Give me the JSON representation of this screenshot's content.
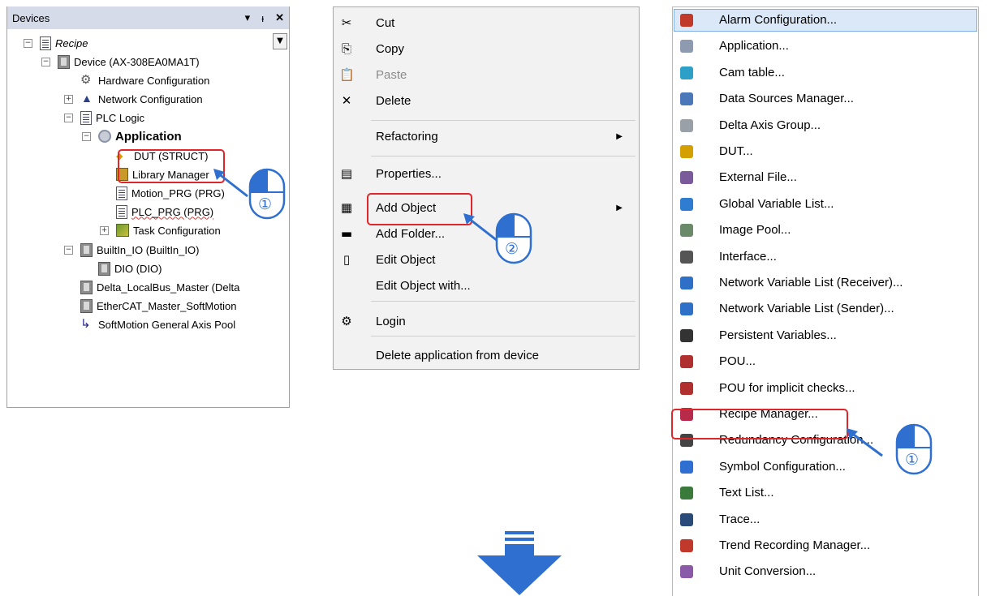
{
  "devices_panel": {
    "title": "Devices",
    "header_buttons": [
      "▾",
      "ᵼ",
      "✕"
    ],
    "tree": [
      {
        "label": "Recipe",
        "icon": "project-icon",
        "style": "ital"
      },
      {
        "label": "Device (AX-308EA0MA1T)",
        "icon": "device-icon"
      },
      {
        "label": "Hardware Configuration",
        "icon": "hardware-config-icon"
      },
      {
        "label": "Network Configuration",
        "icon": "network-config-icon"
      },
      {
        "label": "PLC Logic",
        "icon": "plc-logic-icon"
      },
      {
        "label": "Application",
        "icon": "application-icon",
        "style": "bold"
      },
      {
        "label": "DUT (STRUCT)",
        "icon": "dut-icon"
      },
      {
        "label": "Library Manager",
        "icon": "library-manager-icon"
      },
      {
        "label": "Motion_PRG (PRG)",
        "icon": "program-icon"
      },
      {
        "label": "PLC_PRG (PRG)",
        "icon": "program-icon"
      },
      {
        "label": "Task Configuration",
        "icon": "task-config-icon"
      },
      {
        "label": "BuiltIn_IO (BuiltIn_IO)",
        "icon": "device-icon"
      },
      {
        "label": "DIO (DIO)",
        "icon": "device-icon"
      },
      {
        "label": "Delta_LocalBus_Master (Delta",
        "icon": "device-icon"
      },
      {
        "label": "EtherCAT_Master_SoftMotion",
        "icon": "device-icon"
      },
      {
        "label": "SoftMotion General Axis Pool",
        "icon": "axis-pool-icon"
      }
    ]
  },
  "context_menu": {
    "items": [
      {
        "label": "Cut",
        "icon": "cut-icon",
        "glyph": "✂"
      },
      {
        "label": "Copy",
        "icon": "copy-icon",
        "glyph": "⎘"
      },
      {
        "label": "Paste",
        "icon": "paste-icon",
        "glyph": "📋",
        "disabled": true
      },
      {
        "label": "Delete",
        "icon": "delete-icon",
        "glyph": "✕"
      },
      {
        "label": "Refactoring",
        "submenu": true
      },
      {
        "label": "Properties...",
        "icon": "properties-icon",
        "glyph": "▤"
      },
      {
        "label": "Add Object",
        "icon": "add-object-icon",
        "glyph": "▦",
        "submenu": true
      },
      {
        "label": "Add Folder...",
        "icon": "add-folder-icon",
        "glyph": "▬"
      },
      {
        "label": "Edit Object",
        "icon": "edit-object-icon",
        "glyph": "▯"
      },
      {
        "label": "Edit Object with..."
      },
      {
        "label": "Login",
        "icon": "login-icon",
        "glyph": "⚙"
      },
      {
        "label": "Delete application from device"
      }
    ]
  },
  "object_list": {
    "items": [
      {
        "label": "Alarm Configuration...",
        "icon": "alarm-configuration-icon",
        "color": "#c0392b",
        "selected": true
      },
      {
        "label": "Application...",
        "icon": "application-icon",
        "color": "#8e9ab0"
      },
      {
        "label": "Cam table...",
        "icon": "cam-table-icon",
        "color": "#2ea0c8"
      },
      {
        "label": "Data Sources Manager...",
        "icon": "data-sources-icon",
        "color": "#4a78b8"
      },
      {
        "label": "Delta Axis Group...",
        "icon": "axis-group-icon",
        "color": "#9aa0a8"
      },
      {
        "label": "DUT...",
        "icon": "dut-icon",
        "color": "#d4a000"
      },
      {
        "label": "External File...",
        "icon": "external-file-icon",
        "color": "#7a5a9a"
      },
      {
        "label": "Global Variable List...",
        "icon": "global-variable-icon",
        "color": "#2e7dd1"
      },
      {
        "label": "Image Pool...",
        "icon": "image-pool-icon",
        "color": "#6a8a6a"
      },
      {
        "label": "Interface...",
        "icon": "interface-icon",
        "color": "#555555"
      },
      {
        "label": "Network Variable List (Receiver)...",
        "icon": "nvl-receiver-icon",
        "color": "#2e6fc7"
      },
      {
        "label": "Network Variable List (Sender)...",
        "icon": "nvl-sender-icon",
        "color": "#2e6fc7"
      },
      {
        "label": "Persistent Variables...",
        "icon": "persistent-variables-icon",
        "color": "#333333"
      },
      {
        "label": "POU...",
        "icon": "pou-icon",
        "color": "#b03030"
      },
      {
        "label": "POU for implicit checks...",
        "icon": "pou-implicit-icon",
        "color": "#b03030"
      },
      {
        "label": "Recipe Manager...",
        "icon": "recipe-manager-icon",
        "color": "#b82a4a"
      },
      {
        "label": "Redundancy Configuration...",
        "icon": "redundancy-icon",
        "color": "#444444"
      },
      {
        "label": "Symbol Configuration...",
        "icon": "symbol-config-icon",
        "color": "#2e6fd1"
      },
      {
        "label": "Text List...",
        "icon": "text-list-icon",
        "color": "#3a7a3a"
      },
      {
        "label": "Trace...",
        "icon": "trace-icon",
        "color": "#2a4a7a"
      },
      {
        "label": "Trend Recording Manager...",
        "icon": "trend-recording-icon",
        "color": "#c0392b"
      },
      {
        "label": "Unit Conversion...",
        "icon": "unit-conversion-icon",
        "color": "#8a5aa8"
      }
    ]
  },
  "step_badges": [
    {
      "number": "①"
    },
    {
      "number": "②"
    },
    {
      "number": "①"
    }
  ]
}
